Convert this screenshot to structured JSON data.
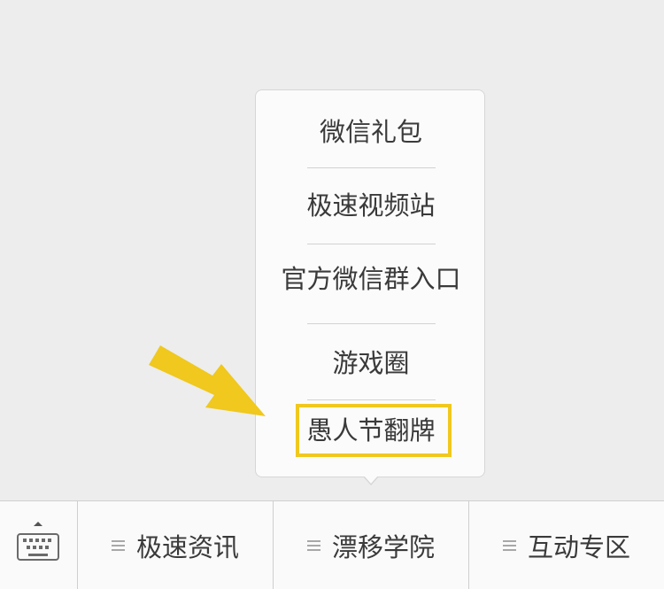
{
  "submenu": {
    "items": [
      {
        "label": "微信礼包"
      },
      {
        "label": "极速视频站"
      },
      {
        "label": "官方微信群入口"
      },
      {
        "label": "游戏圈"
      },
      {
        "label": "愚人节翻牌"
      }
    ],
    "highlighted_item": "愚人节翻牌"
  },
  "annotation": {
    "arrow_color": "#f0c81e",
    "box_color": "#f0c81e"
  },
  "bottom_bar": {
    "keyboard_icon": "keyboard-icon",
    "tabs": [
      {
        "label": "极速资讯",
        "icon": "menu-icon"
      },
      {
        "label": "漂移学院",
        "icon": "menu-icon"
      },
      {
        "label": "互动专区",
        "icon": "menu-icon"
      }
    ]
  }
}
